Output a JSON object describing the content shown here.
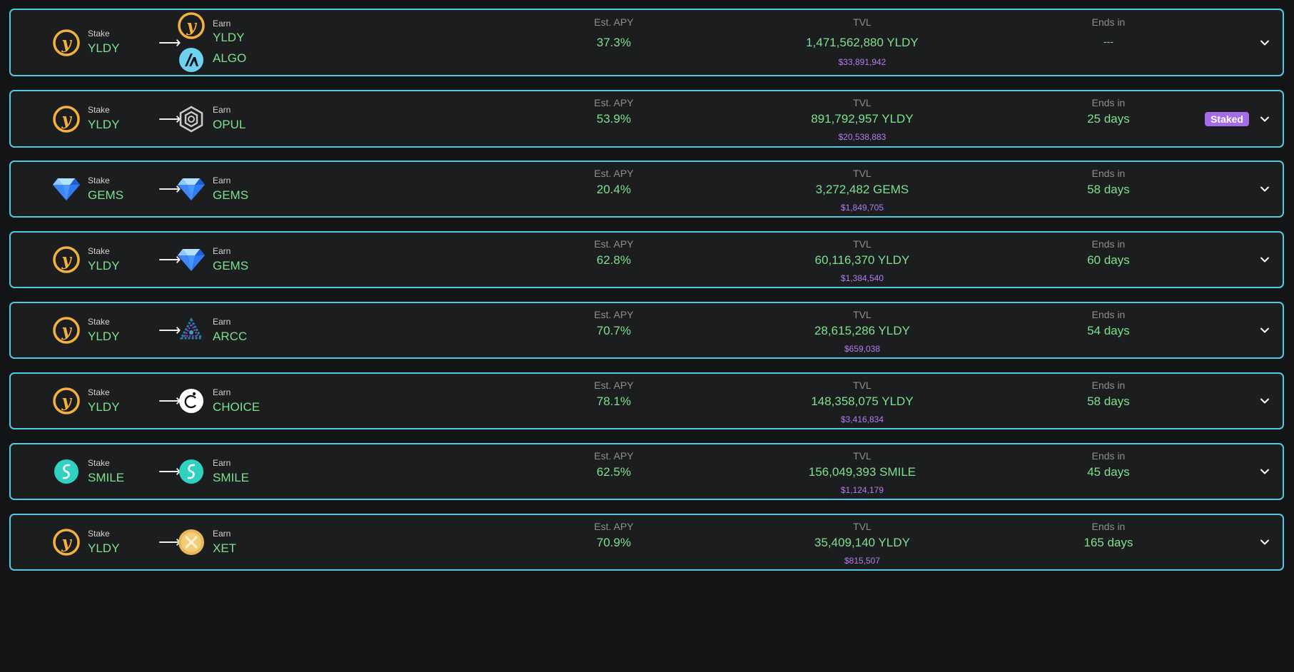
{
  "labels": {
    "stake": "Stake",
    "earn": "Earn",
    "apy": "Est. APY",
    "tvl": "TVL",
    "ends": "Ends in"
  },
  "colors": {
    "border": "#54c8e2",
    "value": "#7ee08e",
    "usd": "#b67cf0",
    "badge": "#a56ce8"
  },
  "pools": [
    {
      "stake_icon": "yldy-icon",
      "stake_symbol": "YLDY",
      "earn": [
        {
          "icon": "yldy-icon",
          "symbol": "YLDY"
        },
        {
          "icon": "algo-icon",
          "symbol": "ALGO"
        }
      ],
      "apy": "37.3%",
      "tvl": "1,471,562,880 YLDY",
      "tvl_usd": "$33,891,942",
      "ends": "---",
      "staked": ""
    },
    {
      "stake_icon": "yldy-icon",
      "stake_symbol": "YLDY",
      "earn": [
        {
          "icon": "opul-icon",
          "symbol": "OPUL"
        }
      ],
      "apy": "53.9%",
      "tvl": "891,792,957 YLDY",
      "tvl_usd": "$20,538,883",
      "ends": "25 days",
      "staked": "Staked"
    },
    {
      "stake_icon": "gems-icon",
      "stake_symbol": "GEMS",
      "earn": [
        {
          "icon": "gems-icon",
          "symbol": "GEMS"
        }
      ],
      "apy": "20.4%",
      "tvl": "3,272,482 GEMS",
      "tvl_usd": "$1,849,705",
      "ends": "58 days",
      "staked": ""
    },
    {
      "stake_icon": "yldy-icon",
      "stake_symbol": "YLDY",
      "earn": [
        {
          "icon": "gems-icon",
          "symbol": "GEMS"
        }
      ],
      "apy": "62.8%",
      "tvl": "60,116,370 YLDY",
      "tvl_usd": "$1,384,540",
      "ends": "60 days",
      "staked": ""
    },
    {
      "stake_icon": "yldy-icon",
      "stake_symbol": "YLDY",
      "earn": [
        {
          "icon": "arcc-icon",
          "symbol": "ARCC"
        }
      ],
      "apy": "70.7%",
      "tvl": "28,615,286 YLDY",
      "tvl_usd": "$659,038",
      "ends": "54 days",
      "staked": ""
    },
    {
      "stake_icon": "yldy-icon",
      "stake_symbol": "YLDY",
      "earn": [
        {
          "icon": "choice-icon",
          "symbol": "CHOICE"
        }
      ],
      "apy": "78.1%",
      "tvl": "148,358,075 YLDY",
      "tvl_usd": "$3,416,834",
      "ends": "58 days",
      "staked": ""
    },
    {
      "stake_icon": "smile-icon",
      "stake_symbol": "SMILE",
      "earn": [
        {
          "icon": "smile-icon",
          "symbol": "SMILE"
        }
      ],
      "apy": "62.5%",
      "tvl": "156,049,393 SMILE",
      "tvl_usd": "$1,124,179",
      "ends": "45 days",
      "staked": ""
    },
    {
      "stake_icon": "yldy-icon",
      "stake_symbol": "YLDY",
      "earn": [
        {
          "icon": "xet-icon",
          "symbol": "XET"
        }
      ],
      "apy": "70.9%",
      "tvl": "35,409,140 YLDY",
      "tvl_usd": "$815,507",
      "ends": "165 days",
      "staked": ""
    }
  ]
}
